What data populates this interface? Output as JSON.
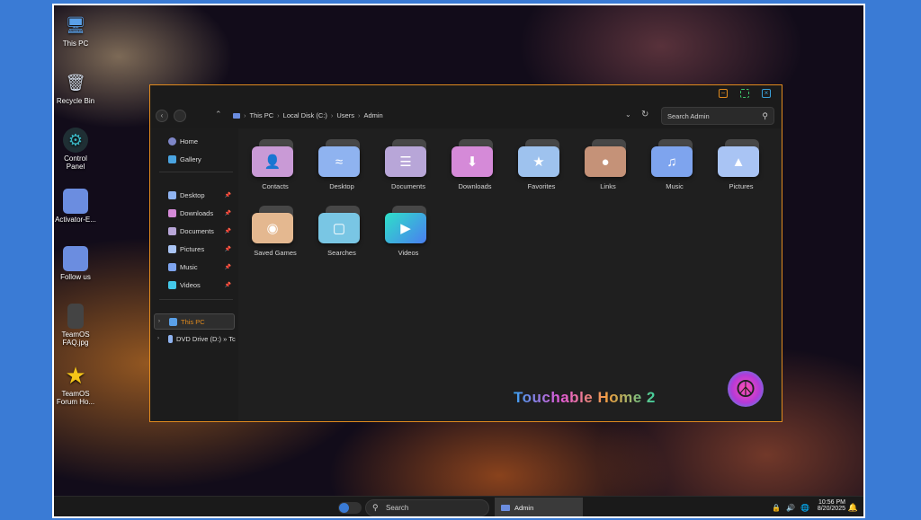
{
  "desktop": {
    "icons": [
      {
        "label": "This PC",
        "icon": "monitor-icon",
        "color": "#5aa0e8"
      },
      {
        "label": "Recycle Bin",
        "icon": "recycle-bin-icon",
        "color": "#cfd8e6"
      },
      {
        "label": "Control Panel",
        "icon": "control-panel-icon",
        "color": "#3bb7c4"
      },
      {
        "label": "Activator-E...",
        "icon": "folder-icon",
        "color": "#6b8de0"
      },
      {
        "label": "Follow us",
        "icon": "folder-icon",
        "color": "#6b8de0"
      },
      {
        "label": "TeamOS FAQ.jpg",
        "icon": "image-file-icon",
        "color": "#444444"
      },
      {
        "label": "TeamOS Forum Ho...",
        "icon": "star-icon",
        "color": "#f5c518"
      }
    ]
  },
  "window": {
    "accent": "#e08a1e",
    "breadcrumb": [
      "This PC",
      "Local Disk (C:)",
      "Users",
      "Admin"
    ],
    "search_placeholder": "Search Admin",
    "sidebar": {
      "home": "Home",
      "gallery": "Gallery",
      "pinned": [
        "Desktop",
        "Downloads",
        "Documents",
        "Pictures",
        "Music",
        "Videos"
      ],
      "this_pc": "This PC",
      "dvd": "DVD Drive (D:) » Tc"
    },
    "folders": [
      {
        "name": "Contacts",
        "icon": "contact-icon",
        "color": "#c99ad6"
      },
      {
        "name": "Desktop",
        "icon": "desktop-icon",
        "color": "#8fb3f0"
      },
      {
        "name": "Documents",
        "icon": "documents-icon",
        "color": "#b8a6d8"
      },
      {
        "name": "Downloads",
        "icon": "download-icon",
        "color": "#d58ad8"
      },
      {
        "name": "Favorites",
        "icon": "star-icon",
        "color": "#9ec2ee"
      },
      {
        "name": "Links",
        "icon": "globe-icon",
        "color": "#c59278"
      },
      {
        "name": "Music",
        "icon": "headphones-icon",
        "color": "#7ea4ee"
      },
      {
        "name": "Pictures",
        "icon": "pictures-icon",
        "color": "#a9c4f4"
      },
      {
        "name": "Saved Games",
        "icon": "gamepad-icon",
        "color": "#e4b890"
      },
      {
        "name": "Searches",
        "icon": "search-folder-icon",
        "color": "#79c6e4"
      },
      {
        "name": "Videos",
        "icon": "video-icon",
        "color": "#44c8e8"
      }
    ],
    "brand_text": "Touchable Home 2"
  },
  "taskbar": {
    "search_label": "Search",
    "app_label": "Admin",
    "time": "10:56 PM",
    "date": "8/20/2025"
  }
}
